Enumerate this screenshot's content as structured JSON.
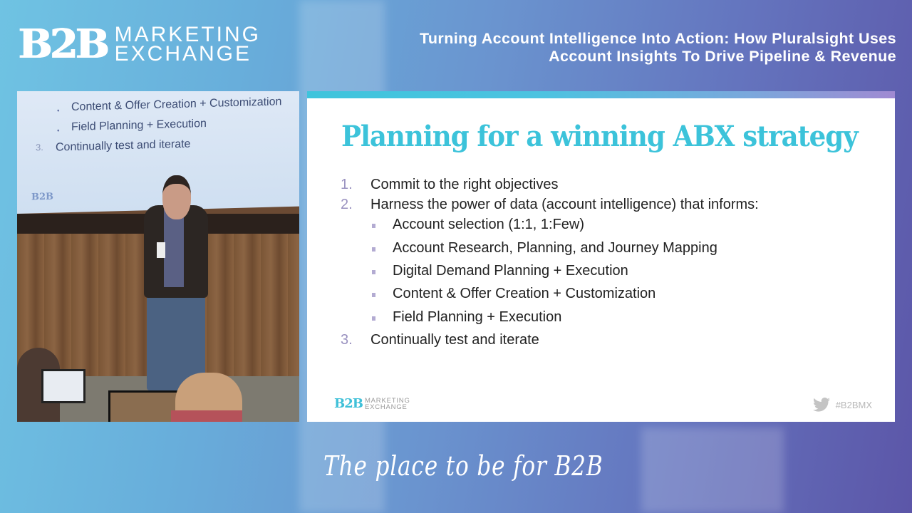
{
  "header": {
    "logo": {
      "mark": "B2B",
      "line1": "MARKETING",
      "line2": "EXCHANGE"
    },
    "talk_title_line1": "Turning Account Intelligence Into Action: How Pluralsight Uses",
    "talk_title_line2": "Account Insights To Drive Pipeline & Revenue"
  },
  "video_feed": {
    "projected_slide_lines": [
      {
        "bullet": "•",
        "text": "Content & Offer Creation + Customization"
      },
      {
        "bullet": "•",
        "text": "Field Planning + Execution"
      },
      {
        "bullet": "3.",
        "text": "Continually test and iterate"
      }
    ],
    "projected_logo": "B2B"
  },
  "slide": {
    "title": "Planning for a winning ABX strategy",
    "items": [
      {
        "num": "1.",
        "text": "Commit to the right objectives"
      },
      {
        "num": "2.",
        "text": "Harness the power of data (account intelligence) that informs:",
        "subitems": [
          "Account selection (1:1, 1:Few)",
          "Account Research, Planning, and Journey Mapping",
          "Digital Demand Planning + Execution",
          "Content & Offer Creation + Customization",
          "Field Planning + Execution"
        ]
      },
      {
        "num": "3.",
        "text": "Continually test and iterate"
      }
    ],
    "footer_logo": {
      "mark": "B2B",
      "line1": "MARKETING",
      "line2": "EXCHANGE"
    },
    "hashtag": "#B2BMX",
    "social_icon": "twitter-icon"
  },
  "tagline": "The place to be for B2B",
  "colors": {
    "title_accent": "#3cc3da",
    "number_color": "#9a92c0",
    "bg_start": "#6fc3e3",
    "bg_end": "#5c56a8"
  }
}
